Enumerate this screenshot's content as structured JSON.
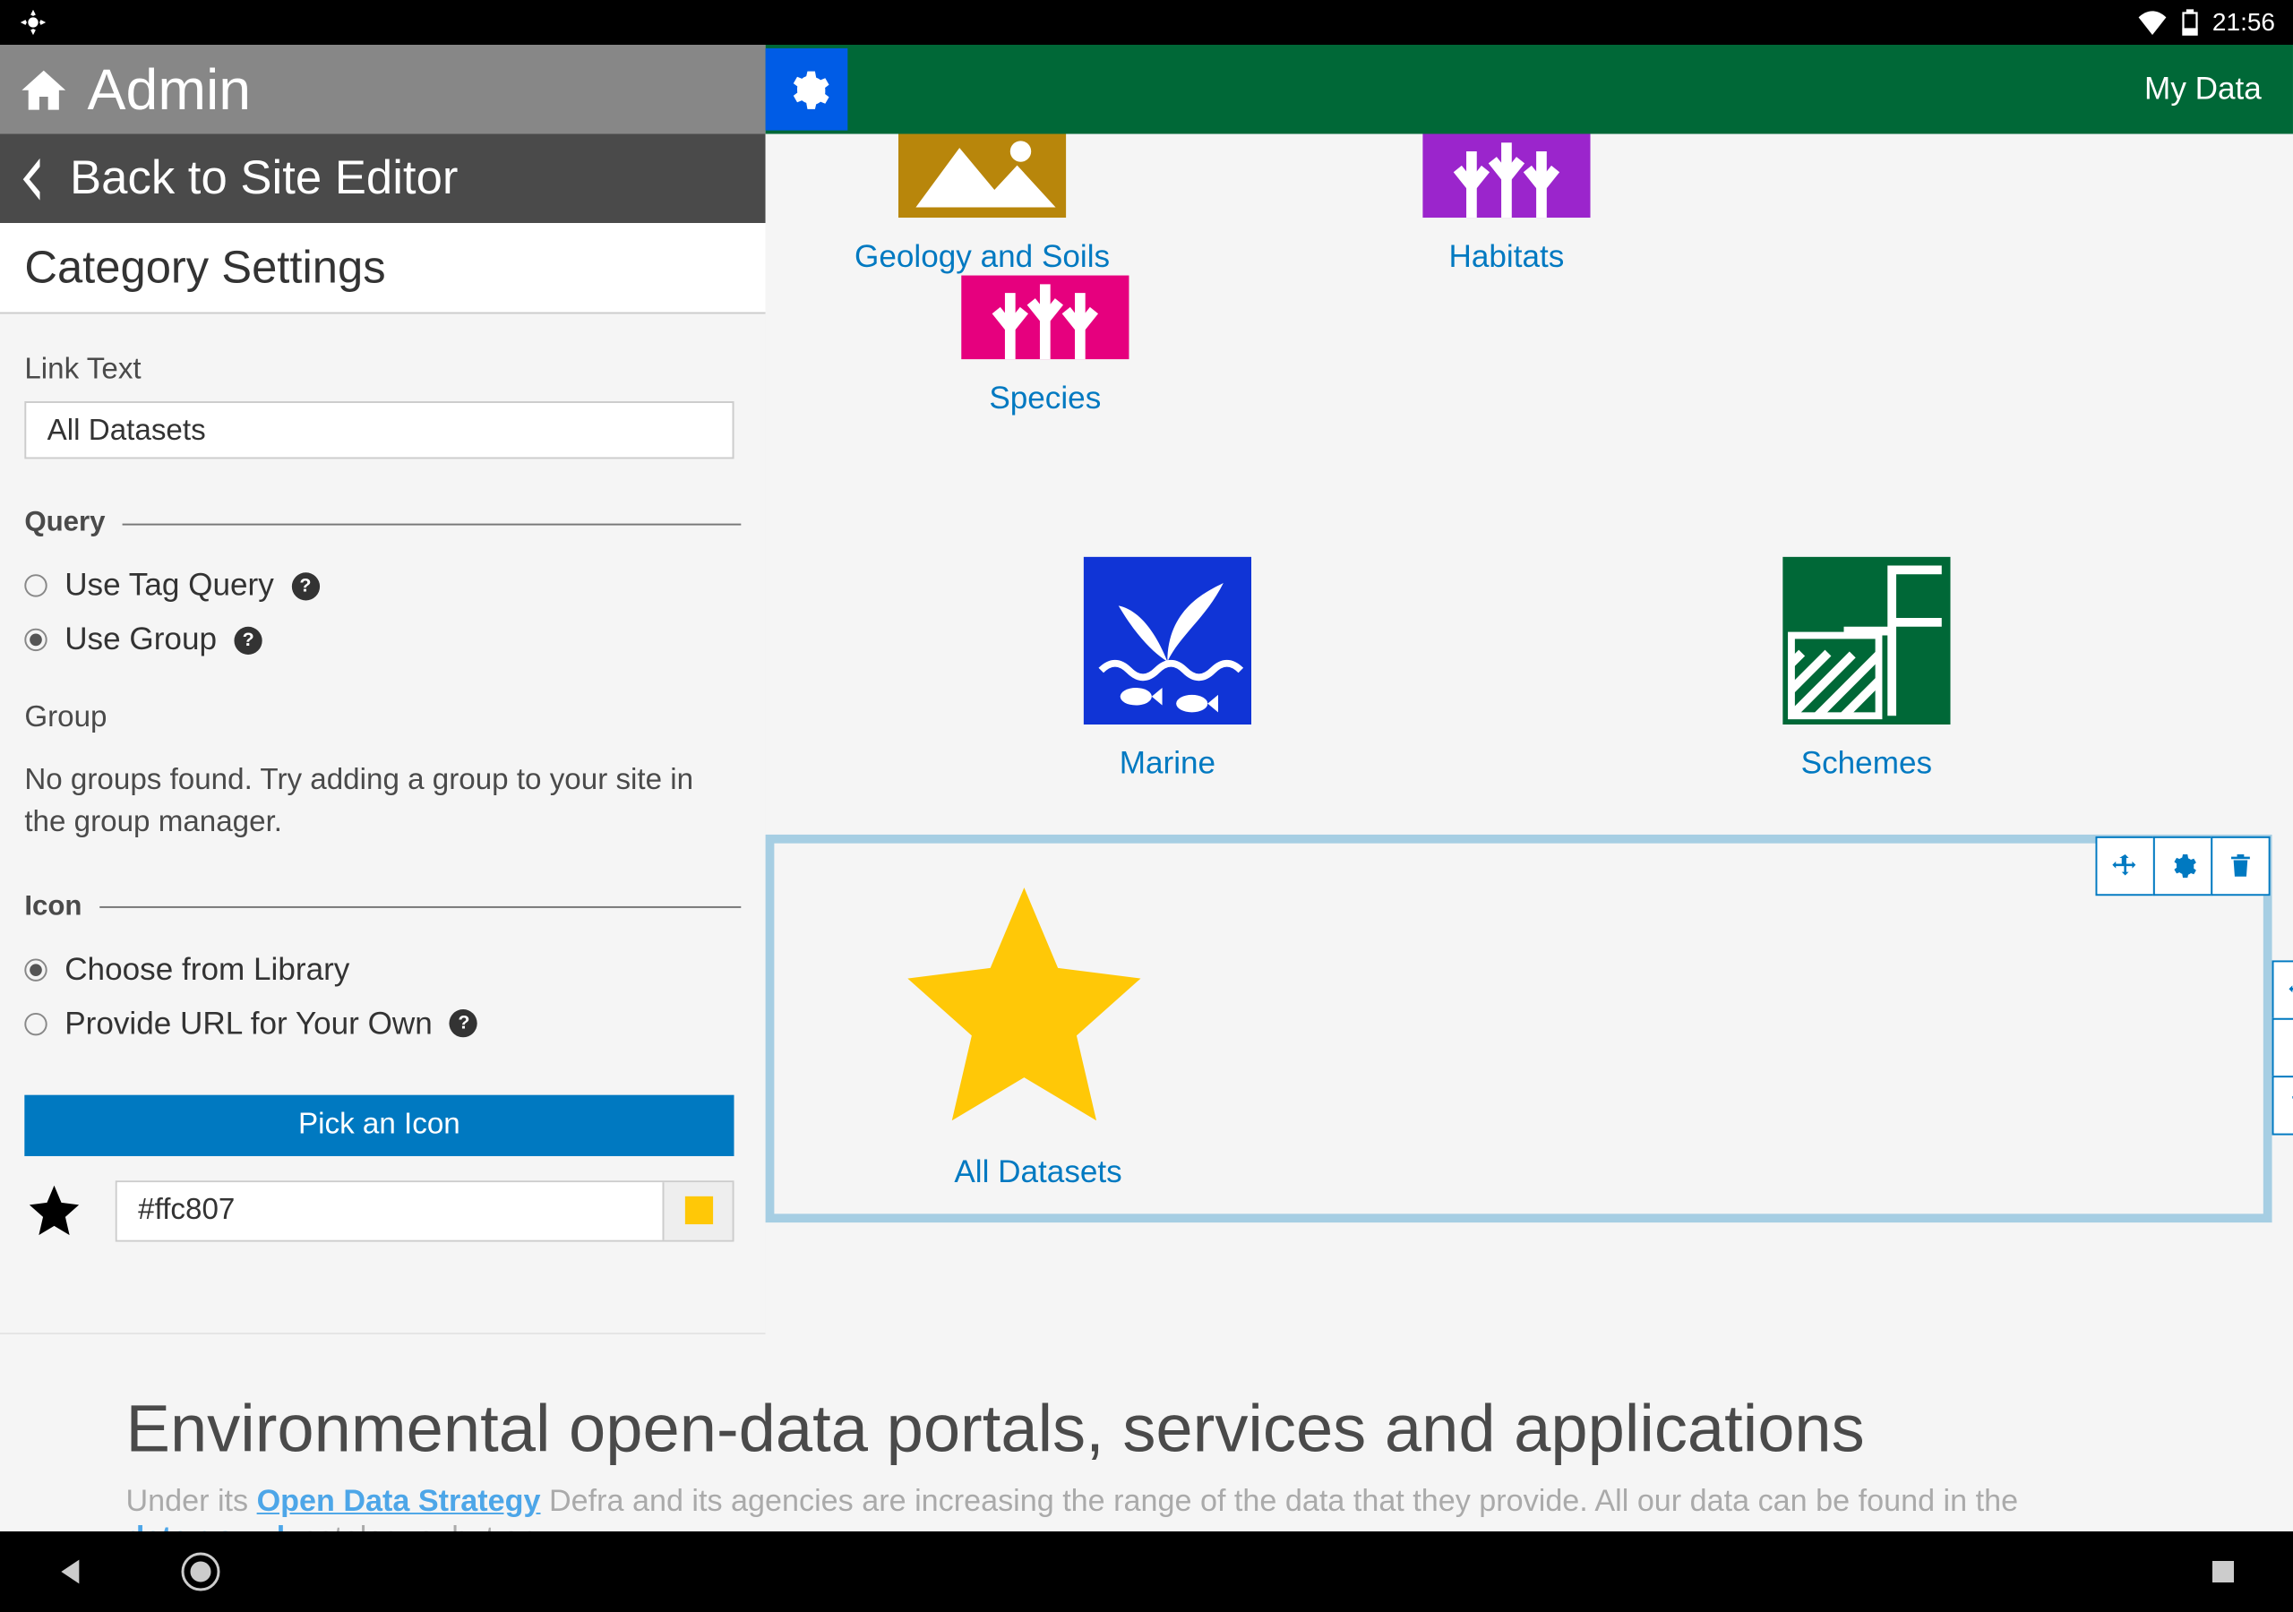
{
  "statusbar": {
    "time": "21:56"
  },
  "sidebar": {
    "admin_label": "Admin",
    "back_label": "Back to Site Editor",
    "category_settings": "Category Settings",
    "link_text_label": "Link Text",
    "link_text_value": "All Datasets",
    "query_label": "Query",
    "use_tag_query": "Use Tag Query",
    "use_group": "Use Group",
    "group_label": "Group",
    "group_empty": "No groups found. Try adding a group to your site in the group manager.",
    "icon_label": "Icon",
    "choose_library": "Choose from Library",
    "provide_url": "Provide URL for Your Own",
    "pick_icon_label": "Pick an Icon",
    "color_value": "#ffc807"
  },
  "header": {
    "my_data": "My Data"
  },
  "categories": {
    "row1": [
      {
        "label": "Geology and Soils"
      },
      {
        "label": "Habitats"
      },
      {
        "label": "Species"
      }
    ],
    "row2": [
      {
        "label": "Marine"
      },
      {
        "label": "Schemes"
      }
    ]
  },
  "selected": {
    "label": "All Datasets"
  },
  "footer": {
    "heading": "Environmental open-data portals, services and applications",
    "prefix": "Under its ",
    "link1": "Open Data Strategy",
    "mid": " Defra and its agencies are increasing the range of the data that they provide. All our data can be found in the ",
    "link2": "data.gov.uk",
    "suffix": " catalogue, but on"
  },
  "colors": {
    "star": "#ffc807",
    "geology": "#B8860B",
    "habitats": "#9b25cc",
    "species": "#e6007e",
    "marine": "#1034d6",
    "schemes": "#006837"
  }
}
